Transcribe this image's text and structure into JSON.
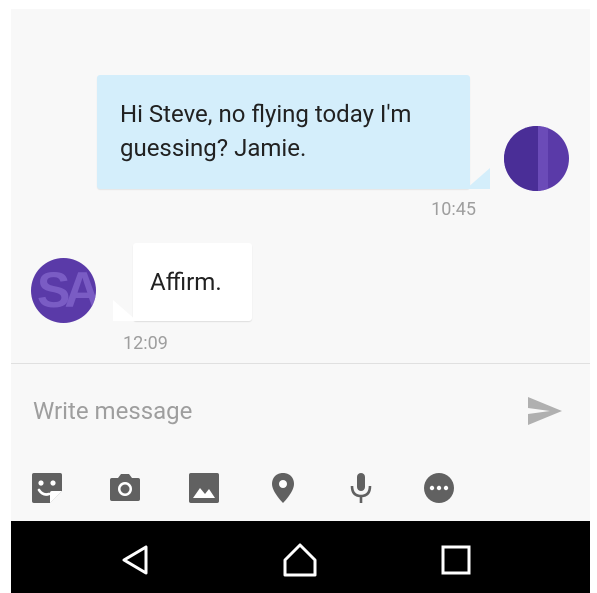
{
  "conversation": {
    "messages": [
      {
        "direction": "outgoing",
        "text_line1": "Hi Steve, no flying today I'm",
        "text_line2": "guessing?  Jamie.",
        "time": "10:45"
      },
      {
        "direction": "incoming",
        "text": "Affirm.",
        "time": "12:09"
      }
    ],
    "avatars": {
      "self_icon": "user-avatar-icon",
      "contact_icon": "contact-avatar-icon",
      "contact_letters": "SA"
    }
  },
  "composer": {
    "placeholder": "Write message",
    "value": "",
    "send_icon": "send-icon",
    "tools": [
      {
        "name": "sticker-icon"
      },
      {
        "name": "camera-icon"
      },
      {
        "name": "gallery-icon"
      },
      {
        "name": "location-icon"
      },
      {
        "name": "microphone-icon"
      },
      {
        "name": "more-icon"
      }
    ]
  },
  "navigation": {
    "buttons": [
      "back-icon",
      "home-icon",
      "recents-icon"
    ]
  },
  "colors": {
    "outgoing_bubble": "#d4eefb",
    "incoming_bubble": "#ffffff",
    "chat_background": "#f8f8f8",
    "icon_gray": "#616161",
    "timestamp_gray": "#9e9e9e",
    "avatar_purple": "#5a3aa8",
    "nav_bar": "#000000"
  }
}
